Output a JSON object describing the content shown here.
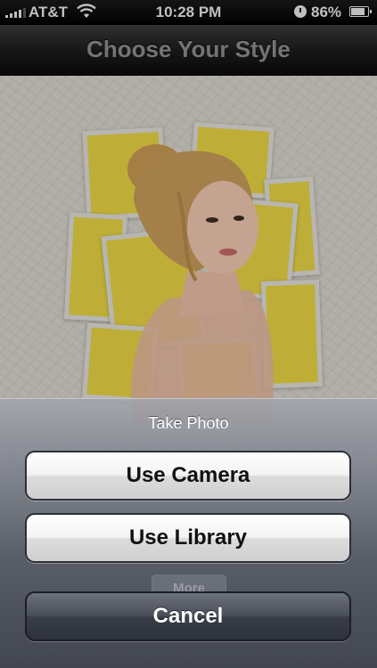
{
  "status_bar": {
    "carrier": "AT&T",
    "time": "10:28 PM",
    "battery_percent": "86%",
    "icons": [
      "signal-icon",
      "wifi-icon",
      "orientation-lock-icon",
      "battery-icon"
    ]
  },
  "nav": {
    "title": "Choose Your Style"
  },
  "background": {
    "accent_color": "#e8d545",
    "partial_button_label": "More"
  },
  "action_sheet": {
    "title": "Take Photo",
    "buttons": [
      {
        "label": "Use Camera"
      },
      {
        "label": "Use Library"
      }
    ],
    "cancel_label": "Cancel"
  }
}
